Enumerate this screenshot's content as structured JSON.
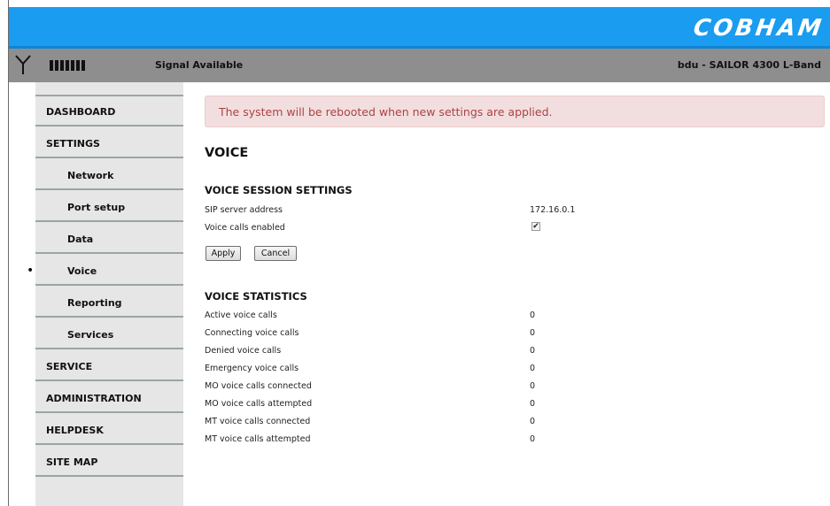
{
  "header": {
    "brand": "COBHAM",
    "signal_status": "Signal Available",
    "device_name": "bdu - SAILOR 4300 L-Band"
  },
  "sidebar": {
    "items": [
      {
        "label": "DASHBOARD",
        "level": "top"
      },
      {
        "label": "SETTINGS",
        "level": "top"
      },
      {
        "label": "Network",
        "level": "sub"
      },
      {
        "label": "Port setup",
        "level": "sub"
      },
      {
        "label": "Data",
        "level": "sub"
      },
      {
        "label": "Voice",
        "level": "sub",
        "active": true
      },
      {
        "label": "Reporting",
        "level": "sub"
      },
      {
        "label": "Services",
        "level": "sub"
      },
      {
        "label": "SERVICE",
        "level": "top"
      },
      {
        "label": "ADMINISTRATION",
        "level": "top"
      },
      {
        "label": "HELPDESK",
        "level": "top"
      },
      {
        "label": "SITE MAP",
        "level": "top"
      }
    ]
  },
  "alert": {
    "text": "The system will be rebooted when new settings are applied."
  },
  "page": {
    "title": "VOICE",
    "session": {
      "title": "VOICE SESSION SETTINGS",
      "sip_label": "SIP server address",
      "sip_value": "172.16.0.1",
      "enabled_label": "Voice calls enabled",
      "enabled_checked": true
    },
    "buttons": {
      "apply": "Apply",
      "cancel": "Cancel"
    },
    "statistics": {
      "title": "VOICE STATISTICS",
      "rows": [
        {
          "label": "Active voice calls",
          "value": "0"
        },
        {
          "label": "Connecting voice calls",
          "value": "0"
        },
        {
          "label": "Denied voice calls",
          "value": "0"
        },
        {
          "label": "Emergency voice calls",
          "value": "0"
        },
        {
          "label": "MO voice calls connected",
          "value": "0"
        },
        {
          "label": "MO voice calls attempted",
          "value": "0"
        },
        {
          "label": "MT voice calls connected",
          "value": "0"
        },
        {
          "label": "MT voice calls attempted",
          "value": "0"
        }
      ]
    }
  },
  "colors": {
    "header_blue": "#1a9cf0",
    "status_gray": "#8e8e8e",
    "sidebar_gray": "#e6e6e6",
    "alert_bg": "#f3dedf",
    "alert_text": "#a94442"
  },
  "icons": {
    "antenna": "antenna-icon",
    "signal": "signal-strength-icon",
    "checkbox": "checkmark-icon"
  }
}
